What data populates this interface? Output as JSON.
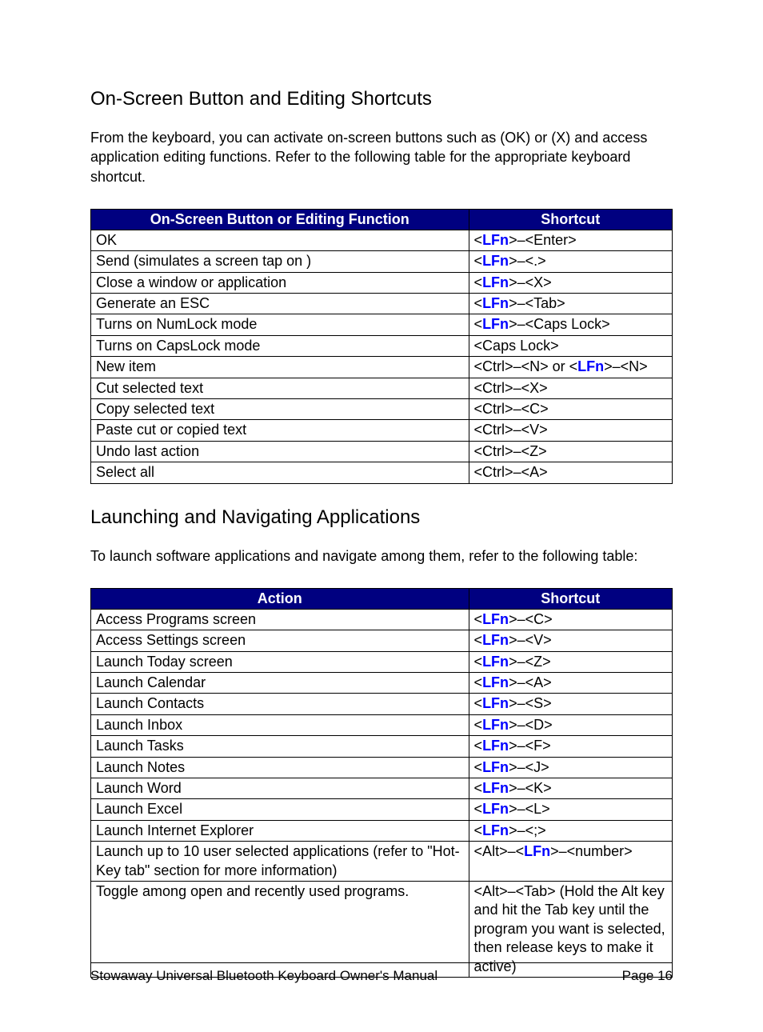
{
  "section1": {
    "heading": "On-Screen Button and Editing Shortcuts",
    "intro": "From the keyboard, you can activate on-screen buttons such as (OK) or (X) and access application editing functions.  Refer to the following table for the appropriate keyboard shortcut.",
    "headers": [
      "On-Screen Button or Editing Function",
      "Shortcut"
    ],
    "rows": [
      {
        "action": "OK",
        "shortcut": [
          {
            "t": "lfn",
            "v": "LFn"
          },
          {
            "t": "txt",
            "v": "–<Enter>"
          }
        ],
        "pre": "<",
        "post": ">"
      },
      {
        "action": "Send (simulates a screen tap on              )",
        "shortcut": [
          {
            "t": "lfn",
            "v": "LFn"
          },
          {
            "t": "txt",
            "v": "–<.>"
          }
        ],
        "pre": "<",
        "post": ">"
      },
      {
        "action": "Close a window or application",
        "shortcut": [
          {
            "t": "lfn",
            "v": "LFn"
          },
          {
            "t": "txt",
            "v": "–<X>"
          }
        ],
        "pre": "<",
        "post": ">"
      },
      {
        "action": "Generate an ESC",
        "shortcut": [
          {
            "t": "lfn",
            "v": "LFn"
          },
          {
            "t": "txt",
            "v": "–<Tab>"
          }
        ],
        "pre": "<",
        "post": ">"
      },
      {
        "action": "Turns on NumLock mode",
        "shortcut": [
          {
            "t": "lfn",
            "v": "LFn"
          },
          {
            "t": "txt",
            "v": "–<Caps Lock>"
          }
        ],
        "pre": "<",
        "post": ">"
      },
      {
        "action": "Turns on CapsLock mode",
        "shortcut": [
          {
            "t": "txt",
            "v": "<Caps Lock>"
          }
        ]
      },
      {
        "action": "New item",
        "shortcut": [
          {
            "t": "txt",
            "v": "<Ctrl>–<N> or <"
          },
          {
            "t": "lfn",
            "v": "LFn"
          },
          {
            "t": "txt",
            "v": ">–<N>"
          }
        ]
      },
      {
        "action": "Cut selected text",
        "shortcut": [
          {
            "t": "txt",
            "v": "<Ctrl>–<X>"
          }
        ]
      },
      {
        "action": "Copy selected text",
        "shortcut": [
          {
            "t": "txt",
            "v": "<Ctrl>–<C>"
          }
        ]
      },
      {
        "action": "Paste cut or copied text",
        "shortcut": [
          {
            "t": "txt",
            "v": "<Ctrl>–<V>"
          }
        ]
      },
      {
        "action": "Undo last action",
        "shortcut": [
          {
            "t": "txt",
            "v": "<Ctrl>–<Z>"
          }
        ]
      },
      {
        "action": "Select all",
        "shortcut": [
          {
            "t": "txt",
            "v": "<Ctrl>–<A>"
          }
        ]
      }
    ]
  },
  "section2": {
    "heading": "Launching and Navigating Applications",
    "intro": "To launch software applications and navigate among them, refer to the following table:",
    "headers": [
      "Action",
      "Shortcut"
    ],
    "rows": [
      {
        "action": "Access Programs screen",
        "shortcut": [
          {
            "t": "lfn",
            "v": "LFn"
          },
          {
            "t": "txt",
            "v": "–<C>"
          }
        ],
        "pre": "<",
        "post": ">"
      },
      {
        "action": "Access Settings screen",
        "shortcut": [
          {
            "t": "lfn",
            "v": "LFn"
          },
          {
            "t": "txt",
            "v": "–<V>"
          }
        ],
        "pre": "<",
        "post": ">"
      },
      {
        "action": "Launch Today screen",
        "shortcut": [
          {
            "t": "lfn",
            "v": "LFn"
          },
          {
            "t": "txt",
            "v": "–<Z>"
          }
        ],
        "pre": "<",
        "post": ">"
      },
      {
        "action": "Launch Calendar",
        "shortcut": [
          {
            "t": "lfn",
            "v": "LFn"
          },
          {
            "t": "txt",
            "v": "–<A>"
          }
        ],
        "pre": "<",
        "post": ">"
      },
      {
        "action": "Launch Contacts",
        "shortcut": [
          {
            "t": "lfn",
            "v": "LFn"
          },
          {
            "t": "txt",
            "v": "–<S>"
          }
        ],
        "pre": "<",
        "post": ">"
      },
      {
        "action": "Launch Inbox",
        "shortcut": [
          {
            "t": "lfn",
            "v": "LFn"
          },
          {
            "t": "txt",
            "v": "–<D>"
          }
        ],
        "pre": "<",
        "post": ">"
      },
      {
        "action": "Launch Tasks",
        "shortcut": [
          {
            "t": "lfn",
            "v": "LFn"
          },
          {
            "t": "txt",
            "v": "–<F>"
          }
        ],
        "pre": "<",
        "post": ">"
      },
      {
        "action": "Launch Notes",
        "shortcut": [
          {
            "t": "lfn",
            "v": "LFn"
          },
          {
            "t": "txt",
            "v": "–<J>"
          }
        ],
        "pre": "<",
        "post": ">"
      },
      {
        "action": "Launch Word",
        "shortcut": [
          {
            "t": "lfn",
            "v": "LFn"
          },
          {
            "t": "txt",
            "v": "–<K>"
          }
        ],
        "pre": "<",
        "post": ">"
      },
      {
        "action": "Launch Excel",
        "shortcut": [
          {
            "t": "lfn",
            "v": "LFn"
          },
          {
            "t": "txt",
            "v": "–<L>"
          }
        ],
        "pre": "<",
        "post": ">"
      },
      {
        "action": "Launch Internet Explorer",
        "shortcut": [
          {
            "t": "lfn",
            "v": "LFn"
          },
          {
            "t": "txt",
            "v": "–<;>"
          }
        ],
        "pre": "<",
        "post": ">"
      },
      {
        "action": "Launch up to 10 user selected applications (refer to \"Hot-Key tab\" section for more information)",
        "shortcut": [
          {
            "t": "txt",
            "v": "<Alt>–<"
          },
          {
            "t": "lfn",
            "v": "LFn"
          },
          {
            "t": "txt",
            "v": ">–<number>"
          }
        ]
      },
      {
        "action": "Toggle among open and recently used programs.",
        "shortcut": [
          {
            "t": "txt",
            "v": "<Alt>–<Tab> (Hold the Alt key and hit the Tab key until the program you want is selected, then release keys to make it active)"
          }
        ]
      }
    ]
  },
  "footer": {
    "left": "Stowaway Universal Bluetooth Keyboard Owner's Manual",
    "right": "Page 16"
  }
}
